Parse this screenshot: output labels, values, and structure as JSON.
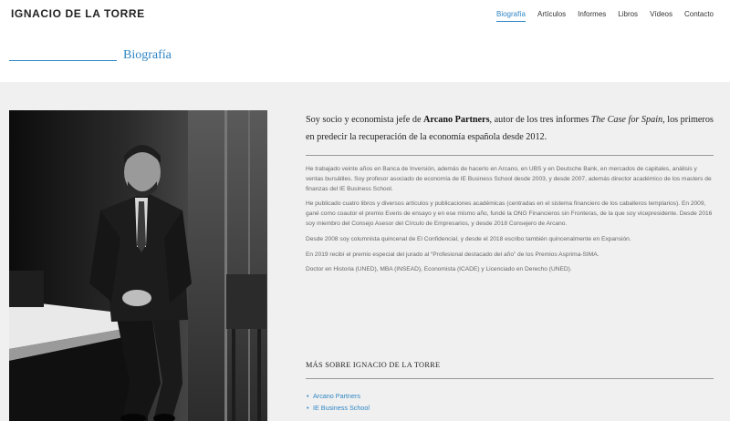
{
  "site": {
    "logo": "IGNACIO DE LA TORRE"
  },
  "nav": {
    "items": [
      "Biografía",
      "Artículos",
      "Informes",
      "Libros",
      "Vídeos",
      "Contacto"
    ],
    "active": "Biografía"
  },
  "section": {
    "title": "Biografía"
  },
  "bio": {
    "lead_1": "Soy socio y economista jefe de ",
    "lead_bold": "Arcano Partners",
    "lead_2": ", autor de los tres informes ",
    "lead_italic": "The Case for Spain",
    "lead_3": ", los primeros en predecir la recuperación de la economía española desde 2012.",
    "paragraphs": [
      "He trabajado veinte años en Banca de Inversión, además de hacerlo en Arcano, en UBS y en Deutsche Bank, en mercados de capitales, análisis y ventas bursátiles. Soy profesor asociado de economía de IE Business School desde 2003, y desde 2007, además director académico de los masters de finanzas del IE Business School.",
      "He publicado cuatro libros y diversos artículos y publicaciones académicas (centradas en el sistema financiero de los caballeros templarios). En 2009, gané como coautor el premio Everis de ensayo y en ese mismo año, fundé la ONG Financieros sin Fronteras, de la que soy vicepresidente. Desde 2016 soy miembro del Consejo Asesor del Círculo de Empresarios, y desde 2018 Consejero de Arcano.",
      "Desde 2008 soy columnista quincenal de El Confidencial, y desde el 2018 escribo también quincenalmente en Expansión.",
      "En 2019 recibí el premio especial del jurado al “Profesional destacado del año” de los Premios Asprima-SIMA.",
      "Doctor en Historia (UNED), MBA (INSEAD), Economista (ICADE) y Licenciado en Derecho (UNED)."
    ]
  },
  "more": {
    "title": "MÁS SOBRE IGNACIO DE LA TORRE",
    "links": [
      "Arcano Partners",
      "IE Business School"
    ]
  },
  "colors": {
    "accent": "#2f86c4",
    "band": "#f0f0f0"
  }
}
